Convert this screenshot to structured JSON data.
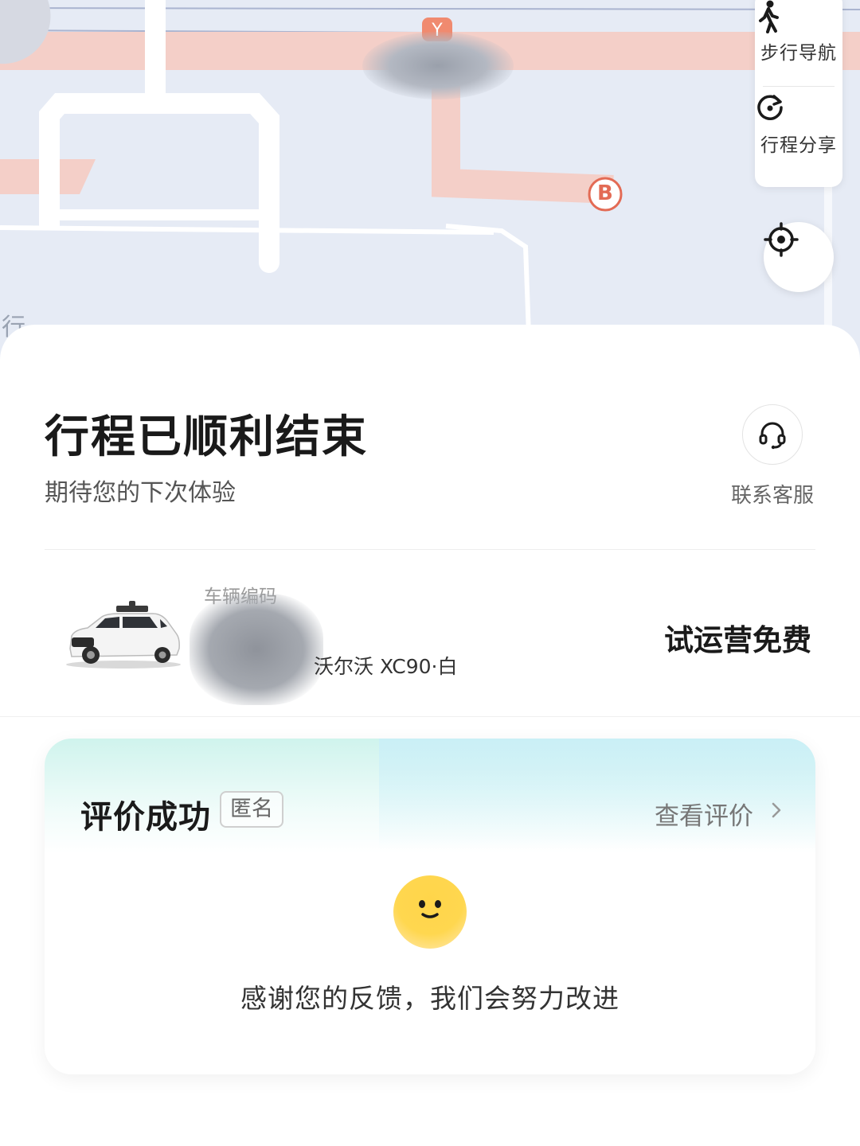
{
  "map": {
    "partial_text": "行",
    "marker_label": "B",
    "panel": {
      "walk_nav_label": "步行导航",
      "trip_share_label": "行程分享"
    }
  },
  "trip": {
    "title": "行程已顺利结束",
    "subtitle": "期待您的下次体验",
    "customer_service_label": "联系客服"
  },
  "vehicle": {
    "code_label": "车辆编码",
    "model": "沃尔沃 XC90·白",
    "price_text": "试运营免费"
  },
  "rating": {
    "title": "评价成功",
    "anonymous_tag": "匿名",
    "view_label": "查看评价",
    "thanks_text": "感谢您的反馈，我们会努力改进"
  }
}
